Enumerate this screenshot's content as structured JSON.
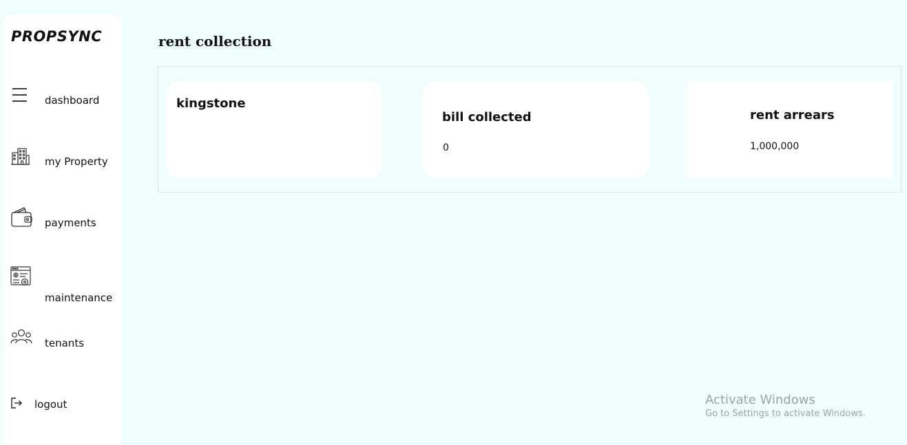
{
  "app": {
    "logo": "PROPSYNC"
  },
  "sidebar": {
    "items": [
      {
        "label": "dashboard",
        "icon": "menu-icon"
      },
      {
        "label": "my Property",
        "icon": "building-icon"
      },
      {
        "label": "payments",
        "icon": "wallet-icon"
      },
      {
        "label": "maintenance",
        "icon": "settings-window-icon"
      },
      {
        "label": "tenants",
        "icon": "users-icon"
      }
    ],
    "logout": {
      "label": "logout",
      "icon": "logout-icon"
    }
  },
  "main": {
    "title": "rent collection",
    "cards": [
      {
        "title": "kingstone"
      },
      {
        "title": "bill collected",
        "value": "0"
      },
      {
        "title": "rent arrears",
        "value": "1,000,000"
      }
    ]
  },
  "watermark": {
    "title": "Activate Windows",
    "subtitle": "Go to Settings to activate Windows."
  }
}
